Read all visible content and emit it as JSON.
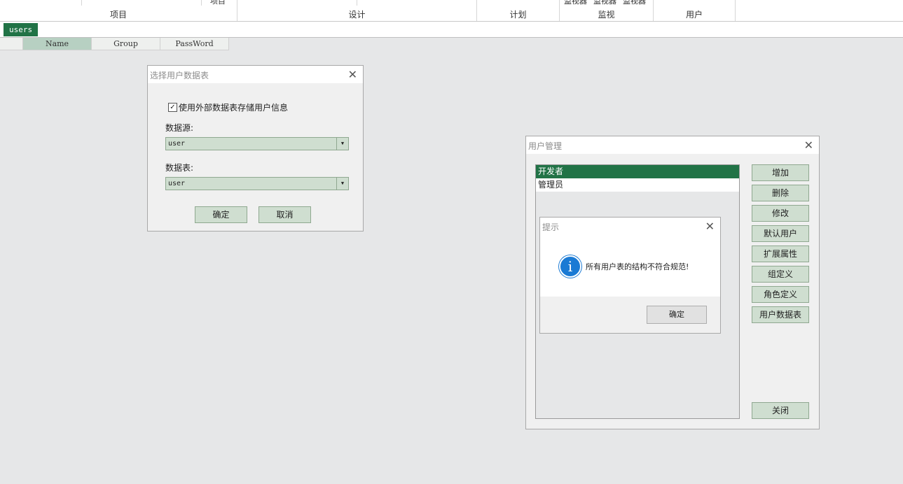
{
  "ribbon": {
    "top_item": "项目",
    "monitors": [
      "监视器",
      "监视器",
      "监视器"
    ],
    "groups": [
      "项目",
      "设计",
      "计划",
      "监视",
      "用户"
    ]
  },
  "tabs": [
    "users"
  ],
  "columns": [
    "Name",
    "Group",
    "PassWord"
  ],
  "select_table_dialog": {
    "title": "选择用户数据表",
    "checkbox_label": "使用外部数据表存储用户信息",
    "checkbox_checked": true,
    "source_label": "数据源:",
    "source_value": "user",
    "table_label": "数据表:",
    "table_value": "user",
    "ok": "确定",
    "cancel": "取消"
  },
  "user_mgmt_dialog": {
    "title": "用户管理",
    "users": [
      "开发者",
      "管理员"
    ],
    "buttons": [
      "增加",
      "删除",
      "修改",
      "默认用户",
      "扩展属性",
      "组定义",
      "角色定义",
      "用户数据表"
    ],
    "close": "关闭"
  },
  "alert": {
    "title": "提示",
    "message": "所有用户表的结构不符合规范!",
    "ok": "确定"
  },
  "colors": {
    "accent": "#217346",
    "button": "#cfded0",
    "info": "#1a7ad4"
  }
}
